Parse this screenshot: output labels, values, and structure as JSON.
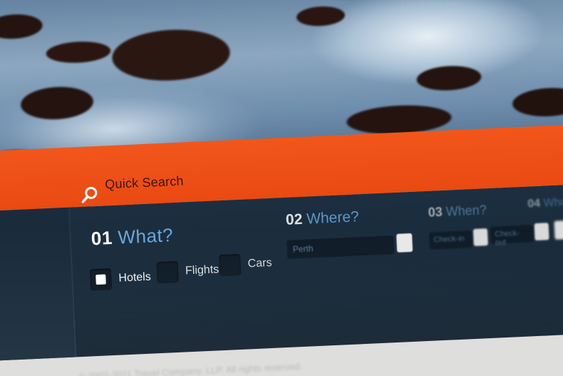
{
  "search_bar": {
    "label": "Quick Search",
    "icon": "search-icon"
  },
  "steps": {
    "what": {
      "num": "01",
      "label": "What?"
    },
    "where": {
      "num": "02",
      "label": "Where?"
    },
    "when": {
      "num": "03",
      "label": "When?"
    },
    "who": {
      "num": "04",
      "label": "Who?"
    }
  },
  "options": [
    {
      "label": "Hotels",
      "checked": true
    },
    {
      "label": "Flights",
      "checked": false
    },
    {
      "label": "Cars",
      "checked": false
    }
  ],
  "where_field": {
    "value": "Perth"
  },
  "date_fields": [
    {
      "placeholder": "Check-in"
    },
    {
      "placeholder": "Check-out"
    }
  ],
  "footer": {
    "text": "© 2002-2011 Travel Company. LLP. All rights reserved."
  },
  "colors": {
    "orange_bar": "#f2561b",
    "panel": "#1c2f40",
    "accent_blue": "#6aa8dd"
  }
}
